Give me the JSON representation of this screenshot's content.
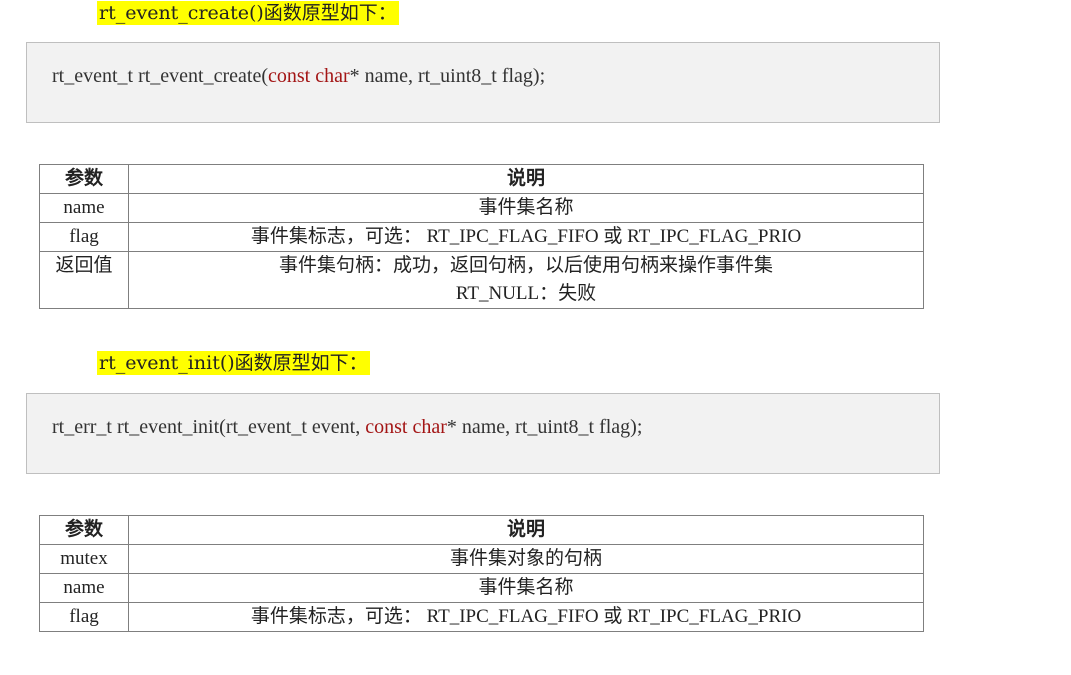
{
  "section1": {
    "heading": "rt_event_create()函数原型如下：",
    "code": {
      "pre": "rt_event_t rt_event_create(",
      "keyword": "const char",
      "post": "* name, rt_uint8_t flag);"
    },
    "table": {
      "header_param": "参数",
      "header_desc": "说明",
      "rows": [
        {
          "param": "name",
          "desc": "事件集名称"
        },
        {
          "param": "flag",
          "desc": "事件集标志，可选： RT_IPC_FLAG_FIFO 或 RT_IPC_FLAG_PRIO"
        },
        {
          "param": "返回值",
          "desc": "事件集句柄：成功，返回句柄，以后使用句柄来操作事件集",
          "desc2": "RT_NULL：失败"
        }
      ]
    }
  },
  "section2": {
    "heading": "rt_event_init()函数原型如下：",
    "code": {
      "pre": "rt_err_t rt_event_init(rt_event_t event, ",
      "keyword": "const char",
      "post": "* name, rt_uint8_t flag);"
    },
    "table": {
      "header_param": "参数",
      "header_desc": "说明",
      "rows": [
        {
          "param": "mutex",
          "desc": "事件集对象的句柄"
        },
        {
          "param": "name",
          "desc": "事件集名称"
        },
        {
          "param": "flag",
          "desc": "事件集标志，可选： RT_IPC_FLAG_FIFO 或 RT_IPC_FLAG_PRIO"
        }
      ]
    }
  },
  "colors": {
    "highlight": "#ffff00",
    "keyword": "#a31515",
    "code_bg": "#f2f2f2"
  }
}
